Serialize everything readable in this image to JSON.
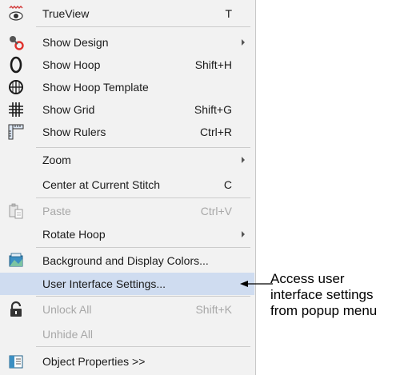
{
  "menu": {
    "items": [
      {
        "label": "TrueView",
        "shortcut": "T",
        "icon": "trueview-icon"
      },
      {
        "label": "Show Design",
        "icon": "show-design-icon",
        "submenu": true
      },
      {
        "label": "Show Hoop",
        "shortcut": "Shift+H",
        "icon": "show-hoop-icon"
      },
      {
        "label": "Show Hoop Template",
        "icon": "hoop-template-icon"
      },
      {
        "label": "Show Grid",
        "shortcut": "Shift+G",
        "icon": "grid-icon"
      },
      {
        "label": "Show Rulers",
        "shortcut": "Ctrl+R",
        "icon": "rulers-icon"
      },
      {
        "label": "Zoom",
        "submenu": true
      },
      {
        "label": "Center at Current Stitch",
        "shortcut": "C"
      },
      {
        "label": "Paste",
        "shortcut": "Ctrl+V",
        "icon": "paste-icon",
        "disabled": true
      },
      {
        "label": "Rotate Hoop",
        "submenu": true
      },
      {
        "label": "Background and Display Colors...",
        "icon": "background-colors-icon"
      },
      {
        "label": "User Interface Settings...",
        "highlighted": true
      },
      {
        "label": "Unlock All",
        "shortcut": "Shift+K",
        "icon": "unlock-icon",
        "disabled": true
      },
      {
        "label": "Unhide All",
        "disabled": true
      },
      {
        "label": "Object Properties >>",
        "icon": "object-properties-icon"
      }
    ]
  },
  "callout": {
    "line1": "Access user",
    "line2": "interface settings",
    "line3": "from popup menu"
  },
  "colors": {
    "highlight": "#cfdcf0",
    "menu_bg": "#f2f2f2",
    "disabled_text": "#a8a8a8"
  }
}
